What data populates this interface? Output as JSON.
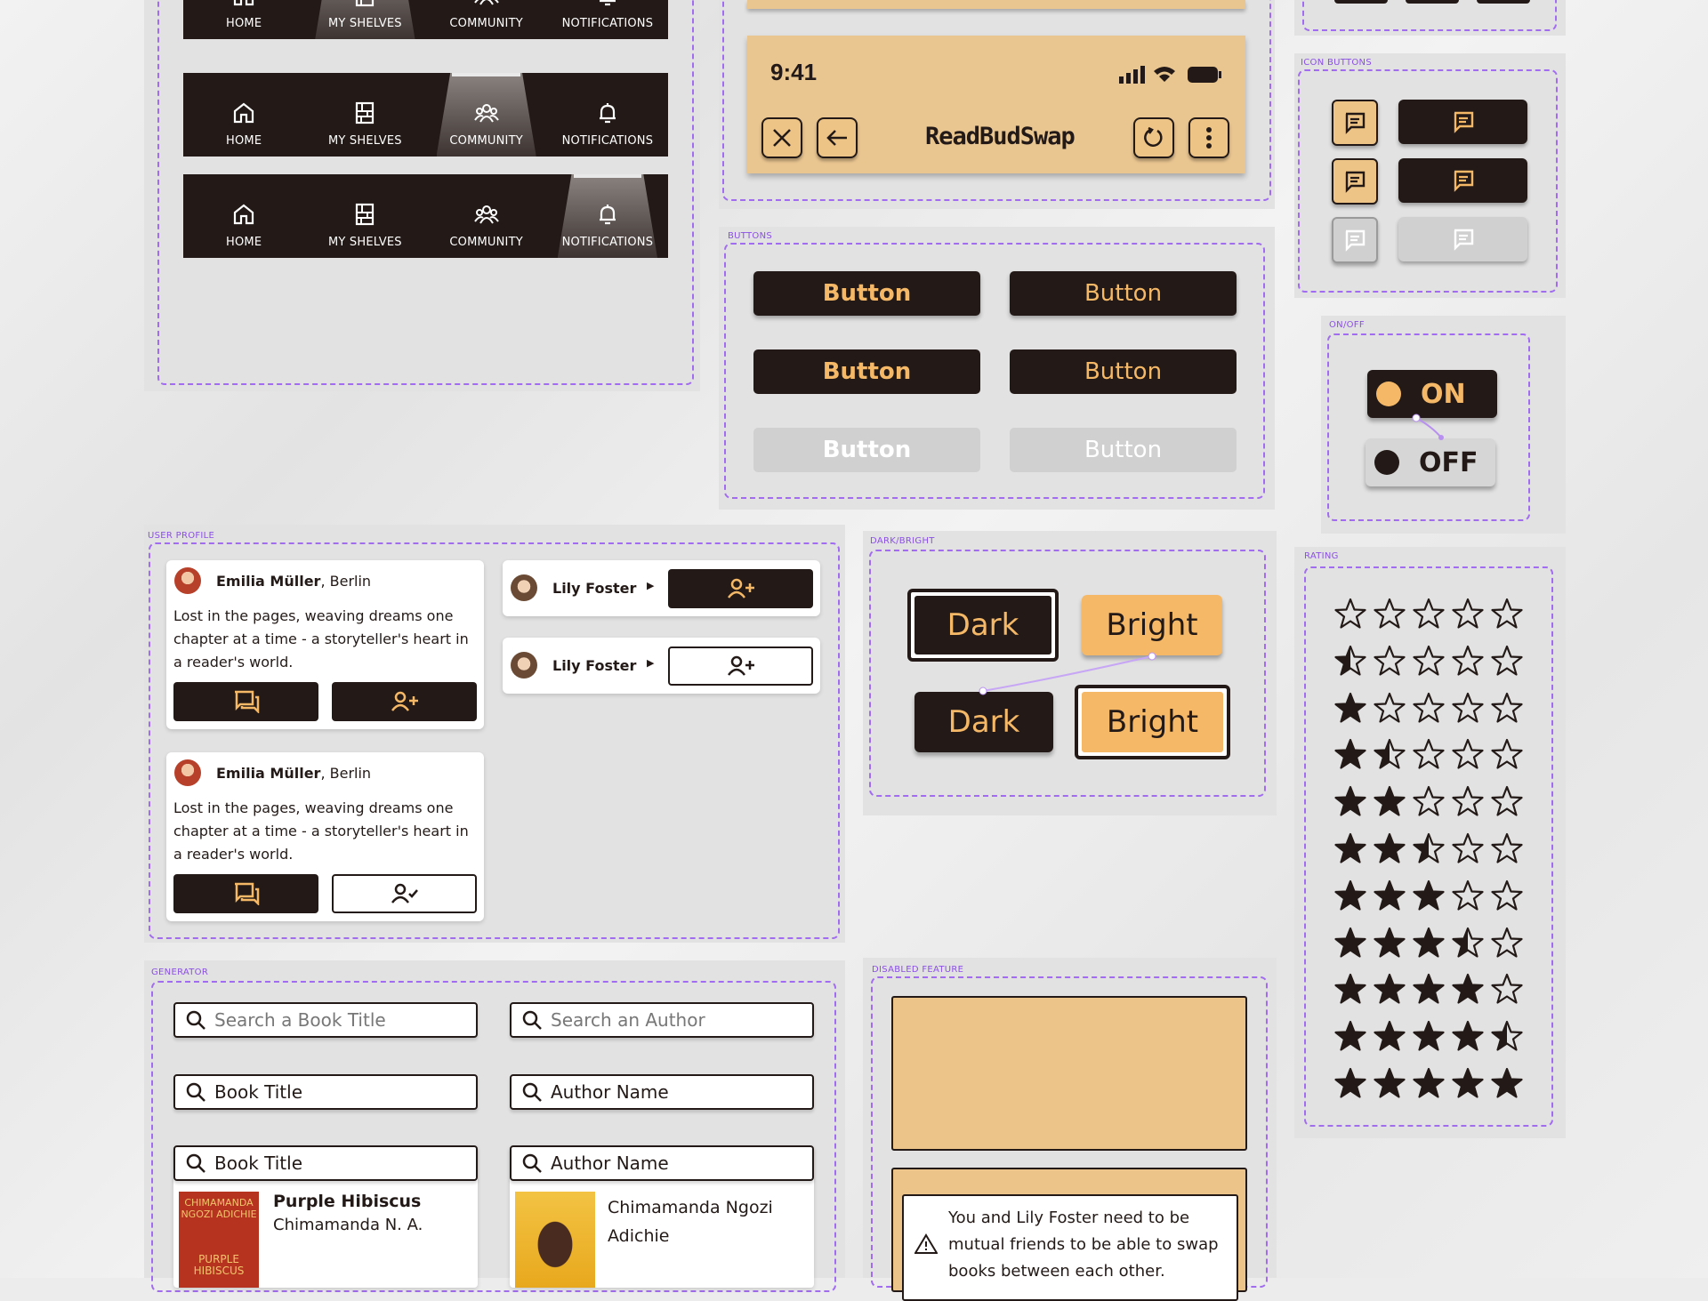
{
  "colors": {
    "dark": "#231a17",
    "accent": "#f5b867",
    "panel": "#e2e2e2",
    "dash": "#a26cf0",
    "disabled": "#d0d0d0"
  },
  "navbars": [
    {
      "active": 1,
      "items": [
        {
          "label": "HOME",
          "icon": "home-icon"
        },
        {
          "label": "MY SHELVES",
          "icon": "shelves-icon"
        },
        {
          "label": "COMMUNITY",
          "icon": "community-icon"
        },
        {
          "label": "NOTIFICATIONS",
          "icon": "bell-icon"
        }
      ]
    },
    {
      "active": 2,
      "items": [
        {
          "label": "HOME",
          "icon": "home-icon"
        },
        {
          "label": "MY SHELVES",
          "icon": "shelves-icon"
        },
        {
          "label": "COMMUNITY",
          "icon": "community-icon"
        },
        {
          "label": "NOTIFICATIONS",
          "icon": "bell-icon"
        }
      ]
    },
    {
      "active": 3,
      "items": [
        {
          "label": "HOME",
          "icon": "home-icon"
        },
        {
          "label": "MY SHELVES",
          "icon": "shelves-icon"
        },
        {
          "label": "COMMUNITY",
          "icon": "community-icon"
        },
        {
          "label": "NOTIFICATIONS",
          "icon": "bell-icon"
        }
      ]
    }
  ],
  "phone": {
    "time": "9:41",
    "app_title": "ReadBudSwap",
    "icons": [
      "close-icon",
      "back-arrow-icon",
      "refresh-icon",
      "more-vertical-icon"
    ]
  },
  "sections": {
    "buttons": "BUTTONS",
    "icon_buttons": "ICON BUTTONS",
    "on_off": "ON/OFF",
    "user_profile": "USER PROFILE",
    "dark_bright": "DARK/BRIGHT",
    "rating": "RATING",
    "generator": "GENERATOR",
    "disabled_feature": "DISABLED FEATURE"
  },
  "buttons": {
    "label": "Button"
  },
  "toggle": {
    "on": "ON",
    "off": "OFF"
  },
  "darkbright": {
    "dark": "Dark",
    "bright": "Bright"
  },
  "profiles": [
    {
      "name": "Emilia Müller",
      "city": ", Berlin",
      "bio": "Lost in the pages, weaving dreams one chapter at a time - a storyteller's heart in a reader's world."
    },
    {
      "name": "Emilia Müller",
      "city": ", Berlin",
      "bio": "Lost in the pages, weaving dreams one chapter at a time - a storyteller's heart in a reader's world."
    }
  ],
  "friends": [
    {
      "name": "Lily Foster"
    },
    {
      "name": "Lily Foster"
    }
  ],
  "rating": {
    "rows": [
      0,
      0.5,
      1,
      1.5,
      2,
      2.5,
      3,
      3.5,
      4,
      4.5,
      5
    ],
    "max": 5
  },
  "generator": {
    "book_placeholder": "Search a Book Title",
    "author_placeholder": "Search an Author",
    "book_value": "Book Title",
    "author_value": "Author Name",
    "book_result": {
      "title": "Purple Hibiscus",
      "author": "Chimamanda N. A.",
      "cover_text_top": "CHIMAMANDA NGOZI ADICHIE",
      "cover_text_bottom": "PURPLE HIBISCUS"
    },
    "author_result": {
      "name": "Chimamanda Ngozi Adichie"
    }
  },
  "disabled": {
    "message": "You and Lily Foster need to be mutual friends to be able to swap books between each other."
  }
}
